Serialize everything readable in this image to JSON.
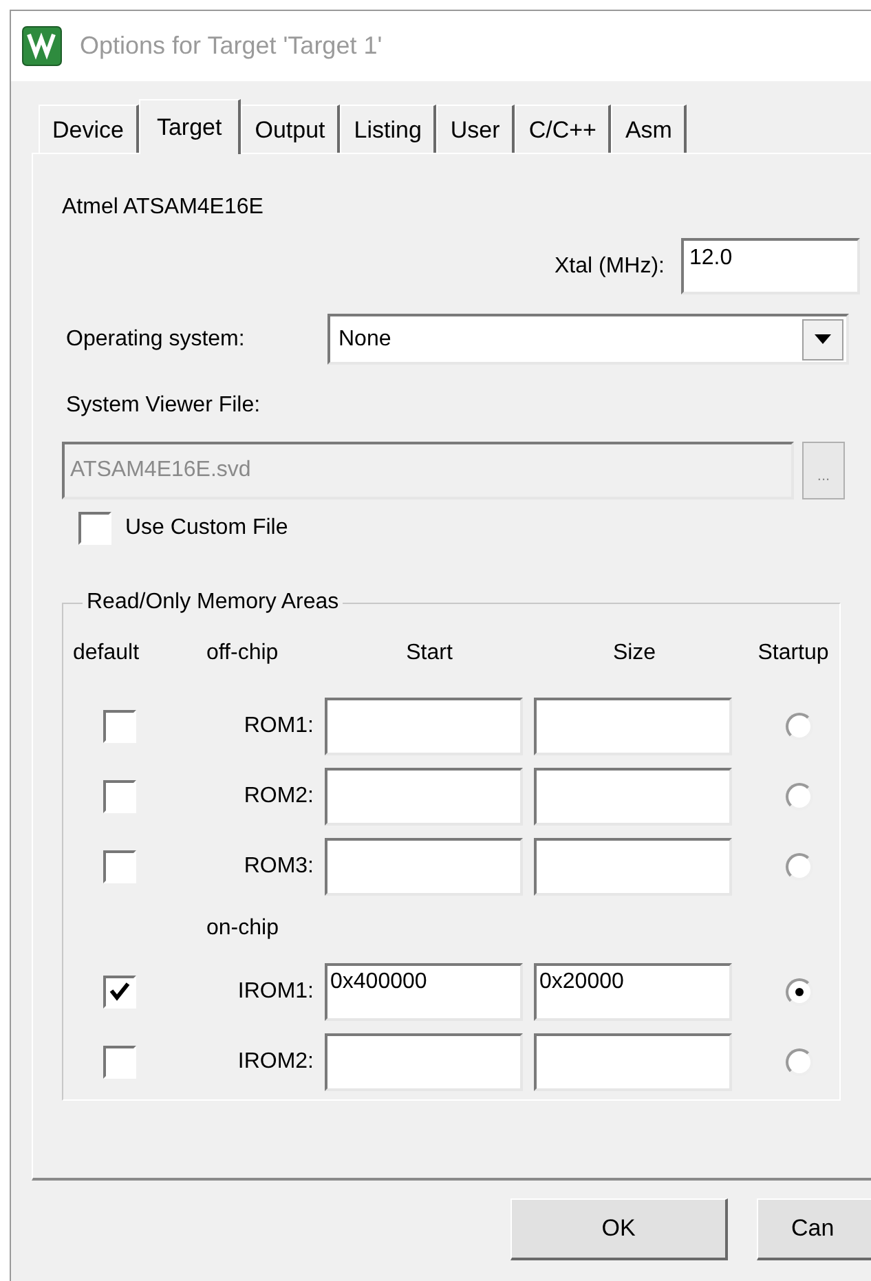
{
  "window": {
    "title": "Options for Target 'Target 1'"
  },
  "tabs": [
    {
      "label": "Device",
      "selected": false
    },
    {
      "label": "Target",
      "selected": true
    },
    {
      "label": "Output",
      "selected": false
    },
    {
      "label": "Listing",
      "selected": false
    },
    {
      "label": "User",
      "selected": false
    },
    {
      "label": "C/C++",
      "selected": false
    },
    {
      "label": "Asm",
      "selected": false
    }
  ],
  "device": "Atmel ATSAM4E16E",
  "xtal": {
    "label": "Xtal (MHz):",
    "value": "12.0"
  },
  "operating_system": {
    "label": "Operating system:",
    "value": "None"
  },
  "system_viewer_file": {
    "label": "System Viewer File:",
    "value": "ATSAM4E16E.svd",
    "disabled": true,
    "browse": "..."
  },
  "use_custom_file": {
    "label": "Use Custom File",
    "checked": false
  },
  "memory_areas": {
    "title": "Read/Only Memory Areas",
    "columns": [
      "default",
      "off-chip",
      "Start",
      "Size",
      "Startup"
    ],
    "rows": [
      {
        "kind": "area",
        "label": "ROM1:",
        "default": false,
        "start": "",
        "size": "",
        "startup": false
      },
      {
        "kind": "area",
        "label": "ROM2:",
        "default": false,
        "start": "",
        "size": "",
        "startup": false
      },
      {
        "kind": "area",
        "label": "ROM3:",
        "default": false,
        "start": "",
        "size": "",
        "startup": false
      },
      {
        "kind": "heading",
        "label": "on-chip"
      },
      {
        "kind": "area",
        "label": "IROM1:",
        "default": true,
        "start": "0x400000",
        "size": "0x20000",
        "startup": true
      },
      {
        "kind": "area",
        "label": "IROM2:",
        "default": false,
        "start": "",
        "size": "",
        "startup": false
      }
    ]
  },
  "buttons": [
    {
      "label": "OK"
    },
    {
      "label": "Can"
    }
  ]
}
